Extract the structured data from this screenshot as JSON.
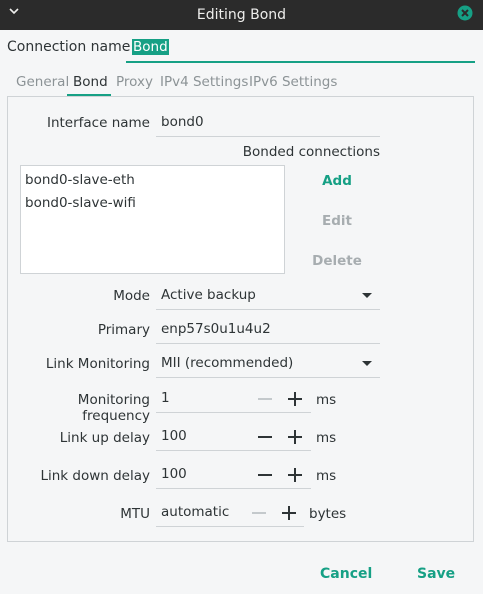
{
  "window": {
    "title": "Editing Bond"
  },
  "connection": {
    "label": "Connection name",
    "value": "Bond"
  },
  "tabs": [
    {
      "label": "General",
      "active": false
    },
    {
      "label": "Bond",
      "active": true
    },
    {
      "label": "Proxy",
      "active": false
    },
    {
      "label": "IPv4 Settings",
      "active": false
    },
    {
      "label": "IPv6 Settings",
      "active": false
    }
  ],
  "bond": {
    "interface_label": "Interface name",
    "interface_value": "bond0",
    "bonded_label": "Bonded connections",
    "bonded": [
      "bond0-slave-eth",
      "bond0-slave-wifi"
    ],
    "add_label": "Add",
    "edit_label": "Edit",
    "delete_label": "Delete",
    "mode_label": "Mode",
    "mode_value": "Active backup",
    "primary_label": "Primary",
    "primary_value": "enp57s0u1u4u2",
    "link_monitoring_label": "Link Monitoring",
    "link_monitoring_value": "MII (recommended)",
    "monitoring_frequency_label": "Monitoring frequency",
    "monitoring_frequency_value": "1",
    "link_up_delay_label": "Link up delay",
    "link_up_delay_value": "100",
    "link_down_delay_label": "Link down delay",
    "link_down_delay_value": "100",
    "ms_unit": "ms",
    "mtu_label": "MTU",
    "mtu_value": "automatic",
    "mtu_unit": "bytes"
  },
  "footer": {
    "cancel_label": "Cancel",
    "save_label": "Save"
  },
  "colors": {
    "accent": "#16a085",
    "titlebar": "#2b2b2b",
    "disabled": "#a7adb0"
  }
}
